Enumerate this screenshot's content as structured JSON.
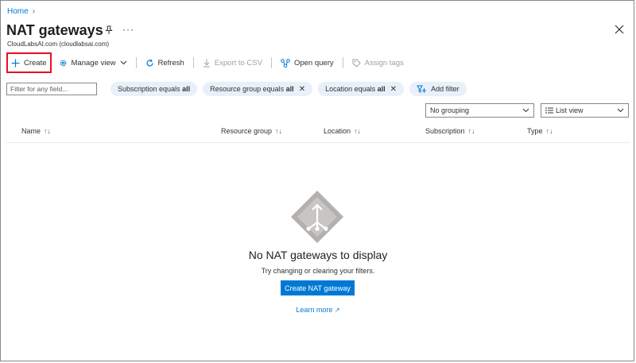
{
  "breadcrumb": {
    "home": "Home"
  },
  "header": {
    "title": "NAT gateways",
    "subtitle": "CloudLabsAI.com (cloudlabsai.com)",
    "more": "···"
  },
  "toolbar": {
    "create": "Create",
    "manage_view": "Manage view",
    "refresh": "Refresh",
    "export_csv": "Export to CSV",
    "open_query": "Open query",
    "assign_tags": "Assign tags"
  },
  "filters": {
    "placeholder": "Filter for any field...",
    "subscription_prefix": "Subscription equals",
    "subscription_value": "all",
    "resource_group_prefix": "Resource group equals",
    "resource_group_value": "all",
    "location_prefix": "Location equals",
    "location_value": "all",
    "add_filter": "Add filter"
  },
  "view": {
    "grouping": "No grouping",
    "list_view": "List view"
  },
  "table": {
    "columns": [
      "Name",
      "Resource group",
      "Location",
      "Subscription",
      "Type"
    ]
  },
  "empty_state": {
    "title": "No NAT gateways to display",
    "subtitle": "Try changing or clearing your filters.",
    "create_button": "Create NAT gateway",
    "learn_more": "Learn more"
  },
  "colors": {
    "accent": "#0078d4",
    "highlight_border": "#e81123"
  }
}
